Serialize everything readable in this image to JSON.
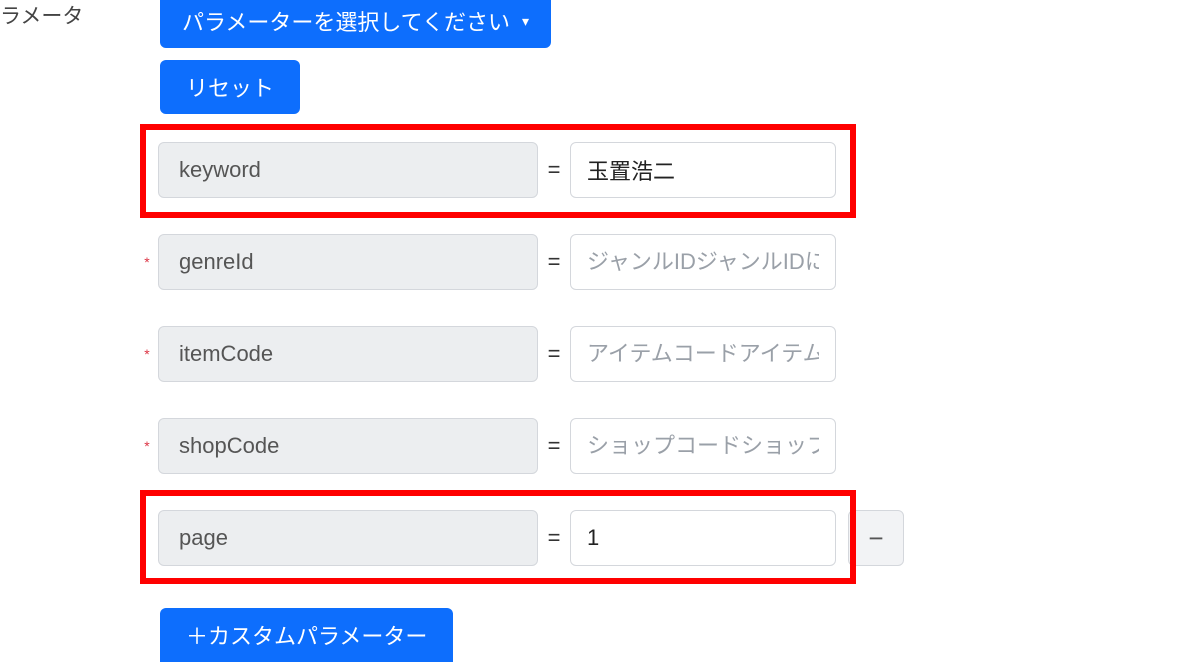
{
  "labels": {
    "section": "ラメータ",
    "dropdown": "パラメーターを選択してください",
    "reset": "リセット",
    "bottom": "＋カスタムパラメーター"
  },
  "rows": {
    "keyword": {
      "label": "keyword",
      "value": "玉置浩二",
      "placeholder": ""
    },
    "genreId": {
      "label": "genreId",
      "value": "",
      "placeholder": "ジャンルIDジャンルIDに一"
    },
    "itemCode": {
      "label": "itemCode",
      "value": "",
      "placeholder": "アイテムコードアイテムコ"
    },
    "shopCode": {
      "label": "shopCode",
      "value": "",
      "placeholder": "ショップコードショップコ"
    },
    "page": {
      "label": "page",
      "value": "1",
      "placeholder": ""
    }
  },
  "symbols": {
    "eq": "=",
    "required": "*",
    "minus": "−",
    "caret": "▾"
  }
}
